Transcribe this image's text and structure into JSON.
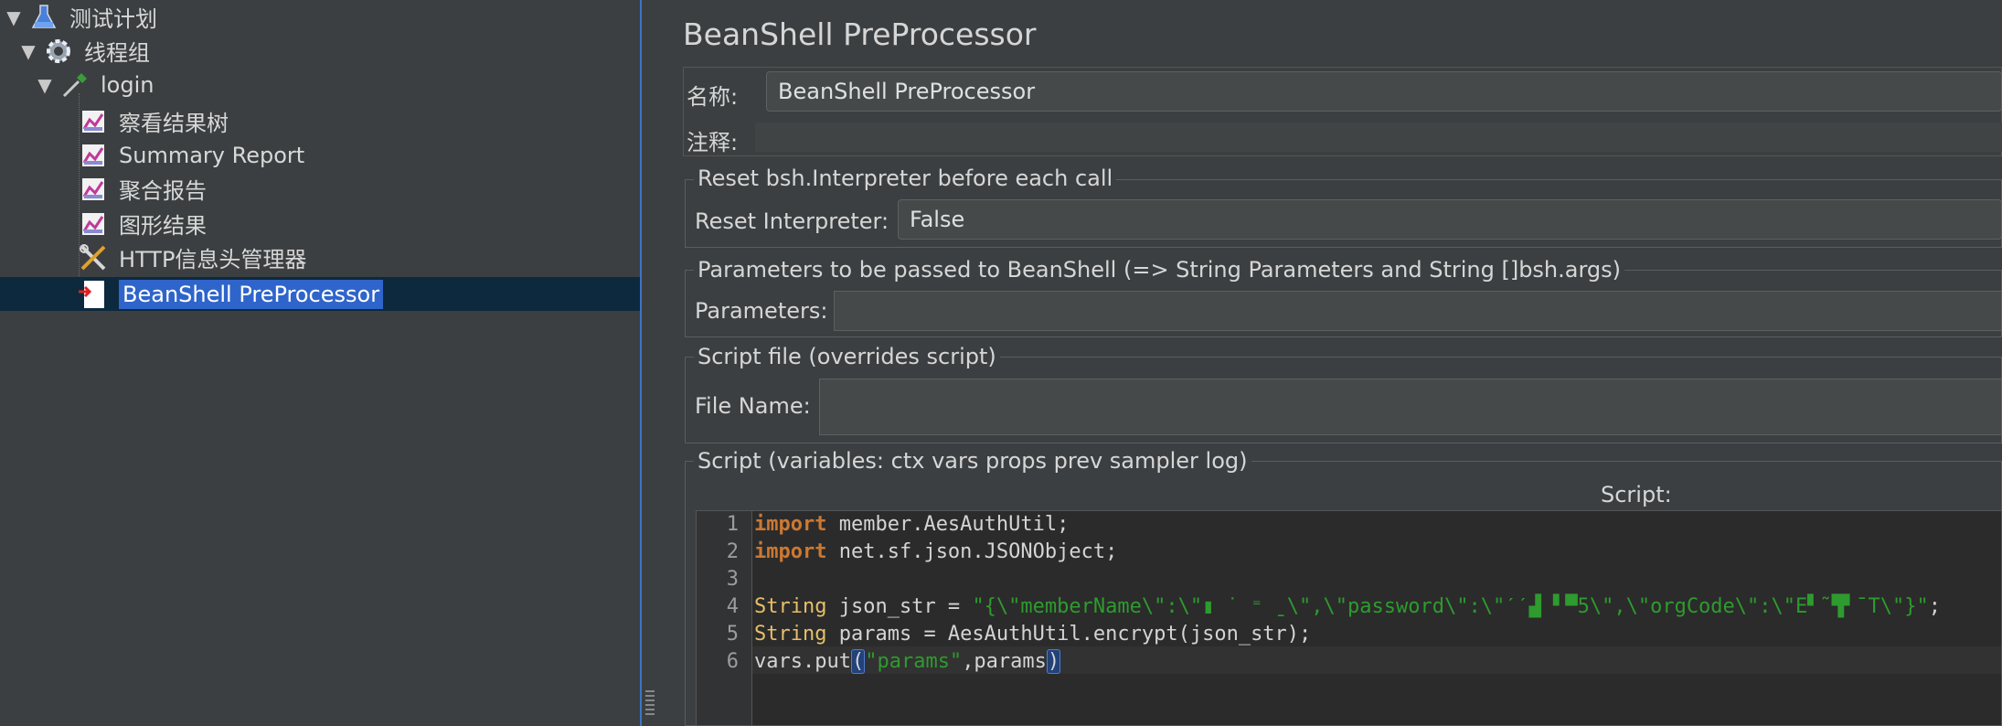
{
  "tree": {
    "items": [
      {
        "label": "测试计划",
        "icon": "flask-icon",
        "level": 0,
        "expanded": true
      },
      {
        "label": "线程组",
        "icon": "gear-icon",
        "level": 1,
        "expanded": true
      },
      {
        "label": "login",
        "icon": "dropper-icon",
        "level": 2,
        "expanded": true
      },
      {
        "label": "察看结果树",
        "icon": "listener-graph-icon",
        "level": 3
      },
      {
        "label": "Summary Report",
        "icon": "listener-graph-icon",
        "level": 3
      },
      {
        "label": "聚合报告",
        "icon": "listener-graph-icon",
        "level": 3
      },
      {
        "label": "图形结果",
        "icon": "listener-graph-icon",
        "level": 3
      },
      {
        "label": "HTTP信息头管理器",
        "icon": "wrench-screwdriver-icon",
        "level": 3
      },
      {
        "label": "BeanShell PreProcessor",
        "icon": "preprocessor-page-icon",
        "level": 3,
        "selected": true
      }
    ]
  },
  "panel": {
    "title": "BeanShell PreProcessor",
    "name_label": "名称:",
    "name_value": "BeanShell PreProcessor",
    "comment_label": "注释:",
    "comment_value": "",
    "reset_group_title": "Reset bsh.Interpreter before each call",
    "reset_label": "Reset Interpreter:",
    "reset_value": "False",
    "params_group_title": "Parameters to be passed to BeanShell (=> String Parameters and String []bsh.args)",
    "params_label": "Parameters:",
    "params_value": "",
    "file_group_title": "Script file (overrides script)",
    "file_label": "File Name:",
    "file_value": "",
    "script_group_title": "Script (variables: ctx vars props prev sampler log)",
    "script_label": "Script:"
  },
  "editor": {
    "line_numbers": [
      "1",
      "2",
      "3",
      "4",
      "5",
      "6"
    ],
    "tokens": {
      "l1_kw": "import",
      "l1_rest": " member.AesAuthUtil;",
      "l2_kw": "import",
      "l2_rest": " net.sf.json.JSONObject;",
      "l4_type": "String",
      "l4_mid": " json_str = ",
      "l4_str": "\"{\\\"memberName\\\":\\\"▮ ˙ ⁼ ˍ\\\",\\\"password\\\":\\\"ˊˊ▟ ▘▀5\\\",\\\"orgCode\\\":\\\"E▘˜▜▘ˉT\\\"}\"",
      "l4_end": ";",
      "l5_type": "String",
      "l5_rest": " params = AesAuthUtil.encrypt(json_str);",
      "l6_a": "vars.put",
      "l6_open": "(",
      "l6_str": "\"params\"",
      "l6_mid": ",params",
      "l6_close": ")"
    }
  },
  "colors": {
    "selection": "#2f65ca",
    "keyword": "#cc7832",
    "type": "#e8bf6a",
    "string": "#2e9b2e"
  }
}
